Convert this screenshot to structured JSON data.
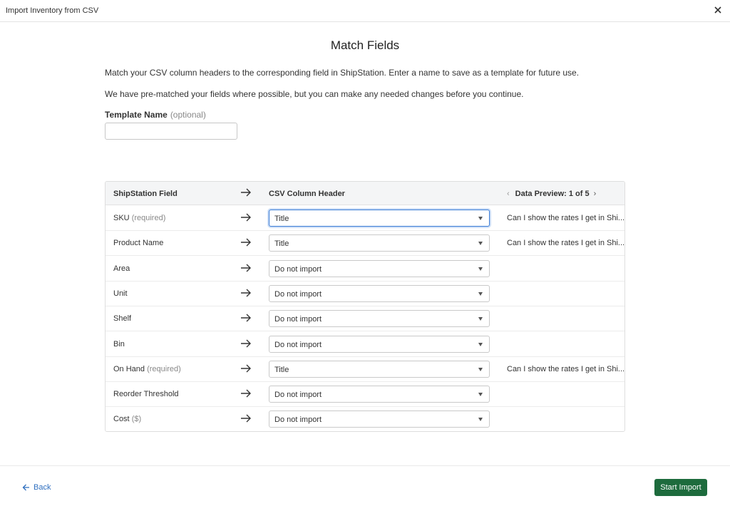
{
  "window": {
    "title": "Import Inventory from CSV"
  },
  "page": {
    "heading": "Match Fields",
    "intro": "Match your CSV column headers to the corresponding field in ShipStation. Enter a name to save as a template for future use.",
    "note": "We have pre-matched your fields where possible, but you can make any needed changes before you continue."
  },
  "template": {
    "label": "Template Name",
    "optional": "(optional)",
    "value": "",
    "placeholder": ""
  },
  "table": {
    "headers": {
      "field": "ShipStation Field",
      "csv": "CSV Column Header",
      "preview": "Data Preview: 1 of 5"
    },
    "rows": [
      {
        "field": "SKU",
        "required": "(required)",
        "selected": "Title",
        "preview": "Can I show the rates I get in Shi..."
      },
      {
        "field": "Product Name",
        "required": "",
        "selected": "Title",
        "preview": "Can I show the rates I get in Shi..."
      },
      {
        "field": "Area",
        "required": "",
        "selected": "Do not import",
        "preview": ""
      },
      {
        "field": "Unit",
        "required": "",
        "selected": "Do not import",
        "preview": ""
      },
      {
        "field": "Shelf",
        "required": "",
        "selected": "Do not import",
        "preview": ""
      },
      {
        "field": "Bin",
        "required": "",
        "selected": "Do not import",
        "preview": ""
      },
      {
        "field": "On Hand",
        "required": "(required)",
        "selected": "Title",
        "preview": "Can I show the rates I get in Shi..."
      },
      {
        "field": "Reorder Threshold",
        "required": "",
        "selected": "Do not import",
        "preview": ""
      },
      {
        "field": "Cost",
        "required": "($)",
        "selected": "Do not import",
        "preview": ""
      }
    ]
  },
  "footer": {
    "back_label": "Back",
    "start_label": "Start Import"
  },
  "colors": {
    "primary_button": "#1d6b3d",
    "link": "#2f6fbf",
    "focus": "#3a7bd5"
  },
  "icons": {
    "close": "close-icon",
    "arrow": "arrow-right-icon",
    "back": "arrow-left-icon",
    "prev": "chevron-left-icon",
    "next": "chevron-right-icon",
    "dropdown": "caret-down-icon"
  }
}
